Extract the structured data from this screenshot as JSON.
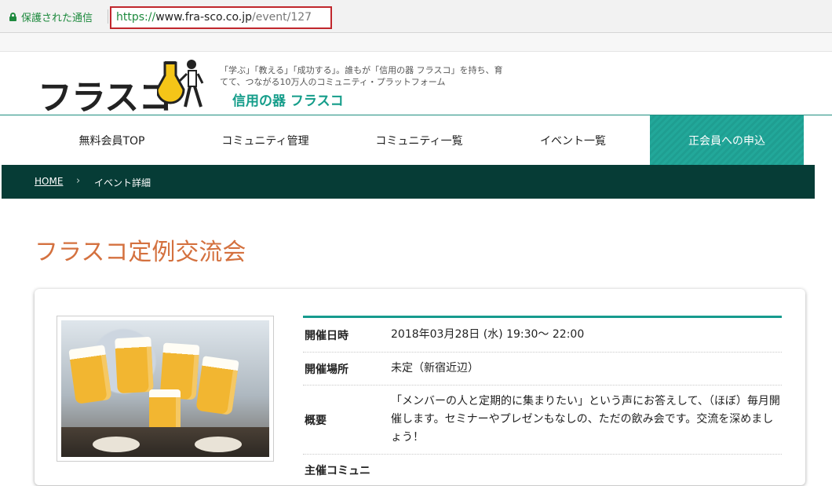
{
  "browser": {
    "secure_label": "保護された通信",
    "url_scheme": "https://",
    "url_host": "www.fra-sco.co.jp",
    "url_path": "/event/127"
  },
  "header": {
    "logo_text": "フラスコ",
    "tagline": "「学ぶ」「教える」「成功する」。誰もが「信用の器 フラスコ」を持ち、育てて、つながる10万人のコミュニティ・プラットフォーム",
    "brand": "信用の器 フラスコ"
  },
  "nav": {
    "items": [
      {
        "label": "無料会員TOP"
      },
      {
        "label": "コミュニティ管理"
      },
      {
        "label": "コミュニティ一覧"
      },
      {
        "label": "イベント一覧"
      },
      {
        "label": "正会員への申込"
      }
    ]
  },
  "breadcrumb": {
    "home": "HOME",
    "current": "イベント詳細"
  },
  "page": {
    "title": "フラスコ定例交流会"
  },
  "event": {
    "rows": [
      {
        "label": "開催日時",
        "value": "2018年03月28日 (水) 19:30～ 22:00"
      },
      {
        "label": "開催場所",
        "value": "未定（新宿近辺）"
      },
      {
        "label": "概要",
        "value": "「メンバーの人と定期的に集まりたい」という声にお答えして、（ほぼ）毎月開催します。セミナーやプレゼンもなしの、ただの飲み会です。交流を深めましょう！"
      },
      {
        "label": "主催コミュニ",
        "value": ""
      }
    ]
  },
  "colors": {
    "accent": "#159d8a",
    "title": "#d4713f",
    "breadcrumb_bg": "#063c36",
    "url_highlight": "#c0272d"
  }
}
